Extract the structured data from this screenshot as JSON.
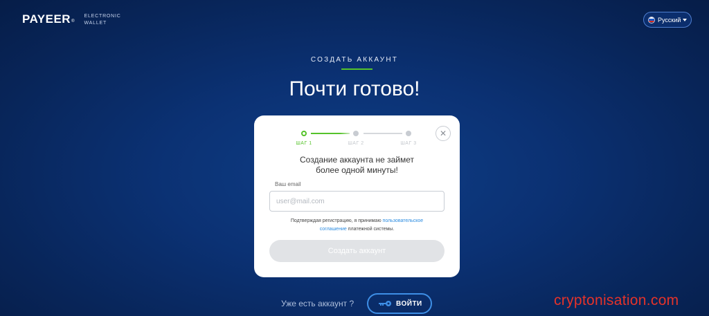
{
  "header": {
    "logo_text": "PAYEER",
    "logo_reg": "®",
    "logo_sub_line1": "ELECTRONIC",
    "logo_sub_line2": "WALLET",
    "language": "Русский"
  },
  "page": {
    "subheading": "СОЗДАТЬ АККАУНТ",
    "title": "Почти готово!"
  },
  "card": {
    "close_symbol": "✕",
    "steps": [
      {
        "label": "ШАГ 1",
        "state": "active"
      },
      {
        "label": "ШАГ 2",
        "state": "inactive"
      },
      {
        "label": "ШАГ 3",
        "state": "inactive"
      }
    ],
    "title_line1": "Создание аккаунта не займет",
    "title_line2": "более одной минуты!",
    "email_label": "Ваш email",
    "email_placeholder": "user@mail.com",
    "email_value": "",
    "agree_text_before": "Подтверждая регистрацию, я принимаю",
    "agree_link_part1": "пользовательское",
    "agree_link_part2": "соглашение",
    "agree_text_after": "платежной системы.",
    "create_button": "Создать аккаунт"
  },
  "footer": {
    "already_text": "Уже есть аккаунт ?",
    "login_button": "ВОЙТИ"
  },
  "watermark": "cryptonisation.com",
  "colors": {
    "accent_green": "#55c32a",
    "link_blue": "#2a8be0",
    "login_border": "#3e8fe6",
    "watermark_red": "#e5332a",
    "background": "#0b3173"
  }
}
